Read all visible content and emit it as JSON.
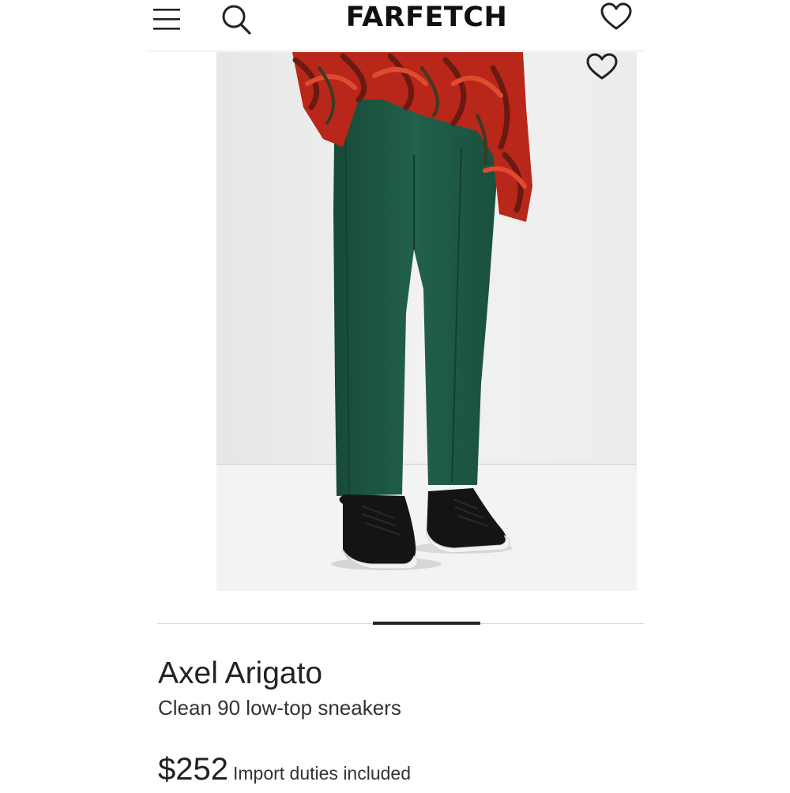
{
  "header": {
    "logo": "FARFETCH",
    "menu_icon": "hamburger-menu-icon",
    "search_icon": "search-icon",
    "wishlist_icon": "heart-icon"
  },
  "product": {
    "image_wishlist_icon": "heart-icon",
    "brand": "Axel Arigato",
    "name": "Clean 90 low-top sneakers",
    "price": "$252",
    "price_note": "Import duties included"
  },
  "colors": {
    "text": "#222222",
    "trousers": "#1f5a45",
    "sweater": "#c02a1c",
    "sneakers": "#141414"
  }
}
